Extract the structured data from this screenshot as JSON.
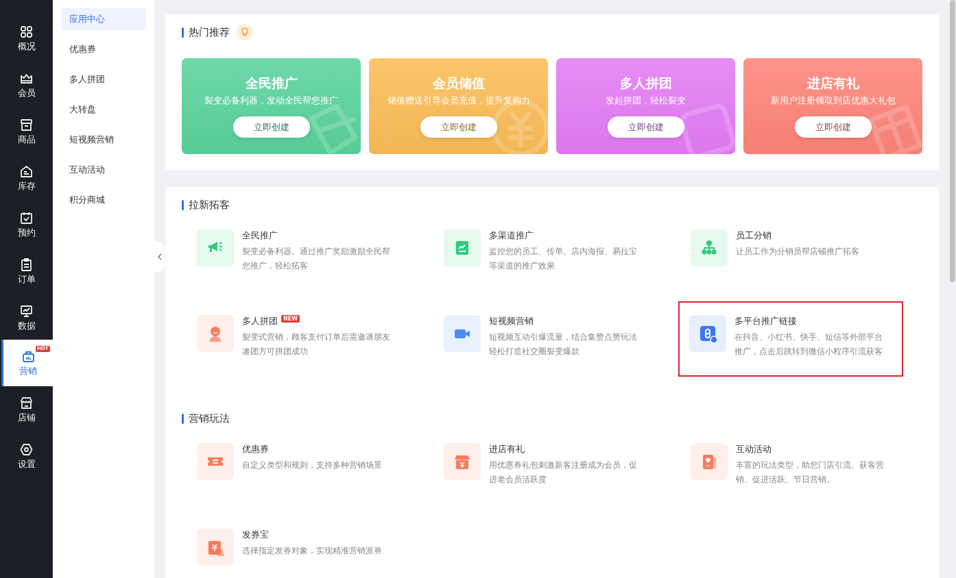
{
  "nav": [
    {
      "label": "概况",
      "kind": "grid",
      "selected": false
    },
    {
      "label": "会员",
      "kind": "crown",
      "selected": false
    },
    {
      "label": "商品",
      "kind": "box",
      "selected": false
    },
    {
      "label": "库存",
      "kind": "house",
      "selected": false
    },
    {
      "label": "预约",
      "kind": "calendar",
      "selected": false
    },
    {
      "label": "订单",
      "kind": "clipboard",
      "selected": false
    },
    {
      "label": "数据",
      "kind": "monitor",
      "selected": false
    },
    {
      "label": "营销",
      "kind": "bag",
      "selected": true,
      "badge": "HOT"
    },
    {
      "label": "店铺",
      "kind": "store",
      "selected": false
    },
    {
      "label": "设置",
      "kind": "gear",
      "selected": false
    }
  ],
  "submenu": [
    {
      "label": "应用中心",
      "selected": true
    },
    {
      "label": "优惠券",
      "selected": false
    },
    {
      "label": "多人拼团",
      "selected": false
    },
    {
      "label": "大转盘",
      "selected": false
    },
    {
      "label": "短视频营销",
      "selected": false
    },
    {
      "label": "互动活动",
      "selected": false
    },
    {
      "label": "积分商城",
      "selected": false
    }
  ],
  "hot": {
    "title": "热门推荐",
    "cards": [
      {
        "title": "全民推广",
        "subtitle": "裂变必备利器，发动全民帮您推广",
        "button": "立即创建",
        "color": "#5ad39d"
      },
      {
        "title": "会员储值",
        "subtitle": "储值赠送引导会员充值，提升复购力",
        "button": "立即创建",
        "color": "#fbbd57"
      },
      {
        "title": "多人拼团",
        "subtitle": "发起拼团，轻松裂变",
        "button": "立即创建",
        "color": "#e47cf5"
      },
      {
        "title": "进店有礼",
        "subtitle": "新用户注册领取到店优惠大礼包",
        "button": "立即创建",
        "color": "#fe8479"
      }
    ]
  },
  "sections": [
    {
      "title": "拉新拓客",
      "items": [
        {
          "name": "全民推广",
          "desc": "裂变必备利器。通过推广奖励激励全民帮您推广，轻松拓客",
          "kind": "megaphone",
          "color": "#2fcc7e",
          "highlighted": false
        },
        {
          "name": "多渠道推广",
          "desc": "监控您的员工、传单、店内海报、易拉宝等渠道的推广效果",
          "kind": "chart",
          "color": "#2fcc7e",
          "highlighted": false
        },
        {
          "name": "员工分销",
          "desc": "让员工作为分销员帮店铺推广拓客",
          "kind": "tree",
          "color": "#2fcc7e",
          "highlighted": false
        },
        {
          "name": "多人拼团",
          "badge": "NEW",
          "desc": "裂变式营销，顾客支付订单后需邀请朋友凑团方可拼团成功",
          "kind": "person",
          "color": "#fa7a5e",
          "highlighted": false
        },
        {
          "name": "短视频营销",
          "desc": "短视频互动引爆流量，结合集赞点赞玩法轻松打造社交圈裂变爆款",
          "kind": "video",
          "color": "#4d8cf5",
          "highlighted": false
        },
        {
          "name": "多平台推广链接",
          "desc": "在抖音、小红书、快手、短信等外部平台推广，点击后跳转到微信小程序引流获客",
          "kind": "link",
          "color": "#3b77f0",
          "highlighted": true
        }
      ]
    },
    {
      "title": "营销玩法",
      "items": [
        {
          "name": "优惠券",
          "desc": "自定义类型和规则，支持多种营销场景",
          "kind": "ticket",
          "color": "#fa7a5e",
          "highlighted": false
        },
        {
          "name": "进店有礼",
          "desc": "用优惠券礼包刺激新客注册成为会员，促进老会员活跃度",
          "kind": "shop",
          "color": "#fa7a5e",
          "highlighted": false
        },
        {
          "name": "互动活动",
          "desc": "丰富的玩法类型，助您门店引流、获客营销、促进活跃、节日营销。",
          "kind": "phone",
          "color": "#fa7a5e",
          "highlighted": false
        },
        {
          "name": "发券宝",
          "desc": "选择指定发券对象，实现精准营销派券",
          "kind": "voucher",
          "color": "#fa7a5e",
          "highlighted": false
        }
      ]
    }
  ]
}
